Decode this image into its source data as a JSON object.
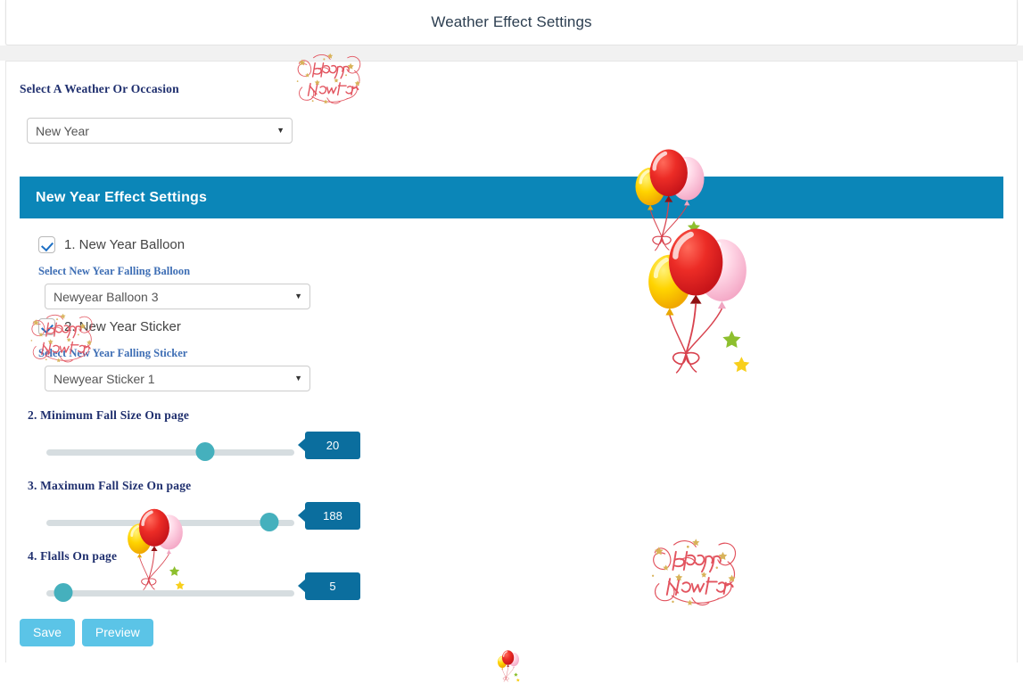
{
  "header": {
    "title": "Weather Effect Settings"
  },
  "occasion": {
    "label": "Select A Weather Or Occasion",
    "selected": "New Year",
    "caret": "▼"
  },
  "section": {
    "title": "New Year Effect Settings"
  },
  "options": [
    {
      "index": "1",
      "checkbox_label": "1. New Year Balloon",
      "checked": true,
      "sub_label": "Select New Year Falling Balloon",
      "selected": "Newyear Balloon 3"
    },
    {
      "index": "2",
      "checkbox_label": "2. New Year Sticker",
      "checked": true,
      "sub_label": "Select New Year Falling Sticker",
      "selected": "Newyear Sticker 1"
    }
  ],
  "sliders": [
    {
      "label": "2. Minimum Fall Size On page",
      "value": "20",
      "percent": 64
    },
    {
      "label": "3. Maximum Fall Size On page",
      "value": "188",
      "percent": 90
    },
    {
      "label": "4. Flalls On page",
      "value": "5",
      "percent": 7
    }
  ],
  "buttons": {
    "save": "Save",
    "preview": "Preview"
  },
  "decor": {
    "sticker_text_top": "Happy",
    "sticker_text_bottom": "New Year",
    "accent_blue": "#0b86b8",
    "badge_blue": "#0b6e9e",
    "thumb_teal": "#45b0bd",
    "button_blue": "#5bc4e7",
    "label_navy": "#1f2f6e",
    "sublabel_blue": "#3f6fb5",
    "sticker_red": "#e2545f",
    "star_gold": "#d8b35a"
  }
}
